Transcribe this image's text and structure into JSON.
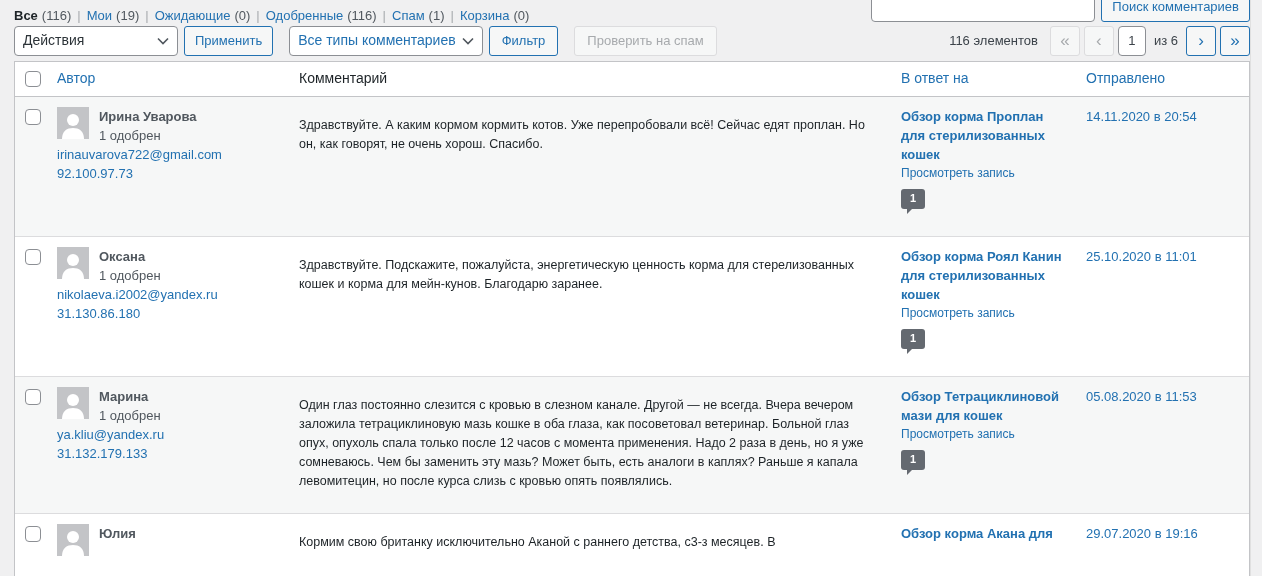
{
  "status_links": [
    {
      "label": "Все",
      "count": "(116)",
      "selected": true
    },
    {
      "separator": "|",
      "label": "Мои",
      "count": "(19)",
      "selected": false
    },
    {
      "separator": "|",
      "label": "Ожидающие",
      "count": "(0)",
      "selected": false
    },
    {
      "separator": "|",
      "label": "Одобренные",
      "count": "(116)",
      "selected": false
    },
    {
      "separator": "|",
      "label": "Спам",
      "count": "(1)",
      "selected": false
    },
    {
      "separator": "|",
      "label": "Корзина",
      "count": "(0)",
      "selected": false
    }
  ],
  "search": {
    "button": "Поиск комментариев"
  },
  "toolbar": {
    "bulk_action": "Действия",
    "apply": "Применить",
    "type_filter": "Все типы комментариев",
    "filter": "Фильтр",
    "spam_check": {
      "label": "Проверить на спам",
      "disabled": true
    }
  },
  "pagination": {
    "items": "116 элементов",
    "first": {
      "label": "«",
      "disabled": true
    },
    "prev": {
      "label": "‹",
      "disabled": true
    },
    "page": "1",
    "of": "из 6",
    "next": {
      "label": "›",
      "disabled": false
    },
    "last": {
      "label": "»",
      "disabled": false
    }
  },
  "table": {
    "select_all_checked": false,
    "columns": [
      "Автор",
      "Комментарий",
      "В ответ на",
      "Отправлено"
    ],
    "rows": [
      {
        "checked": false,
        "name": "Ирина Уварова",
        "approved": "1 одобрен",
        "email": "irinauvarova722@gmail.com",
        "ip": "92.100.97.73",
        "comment": "Здравствуйте. А каким кормом кормить котов. Уже перепробовали всё! Сейчас едят проплан. Но он, как говорят, не очень хорош. Спасибо.",
        "post": "Обзор корма Проплан для стерилизованных кошек",
        "view": "Просмотреть запись",
        "bubble": "1",
        "date": "14.11.2020 в 20:54"
      },
      {
        "checked": false,
        "name": "Оксана",
        "approved": "1 одобрен",
        "email": "nikolaeva.i2002@yandex.ru",
        "ip": "31.130.86.180",
        "comment": "Здравствуйте. Подскажите, пожалуйста, энергетическую ценность корма для стерелизованных кошек и корма для мейн-кунов. Благодарю заранее.",
        "post": "Обзор корма Роял Канин для стерилизованных кошек",
        "view": "Просмотреть запись",
        "bubble": "1",
        "date": "25.10.2020 в 11:01"
      },
      {
        "checked": false,
        "name": "Марина",
        "approved": "1 одобрен",
        "email": "ya.kliu@yandex.ru",
        "ip": "31.132.179.133",
        "comment": "Один глаз постоянно слезится с кровью в слезном канале. Другой — не всегда. Вчера вечером заложила тетрациклиновую мазь кошке в оба глаза, как посоветовал ветеринар. Больной глаз опух, опухоль спала только после 12 часов с момента применения. Надо 2 раза в день, но я уже сомневаюсь. Чем бы заменить эту мазь? Может быть, есть аналоги в каплях? Раньше я капала левомитецин, но после курса слизь с кровью опять появлялись.",
        "post": "Обзор Тетрациклиновой мази для кошек",
        "view": "Просмотреть запись",
        "bubble": "1",
        "date": "05.08.2020 в 11:53"
      },
      {
        "checked": false,
        "name": "Юлия",
        "comment": "Кормим свою британку исключительно Аканой с раннего детства, с3-з месяцев. В",
        "post": "Обзор корма Акана для",
        "date": "29.07.2020 в 19:16"
      }
    ]
  }
}
